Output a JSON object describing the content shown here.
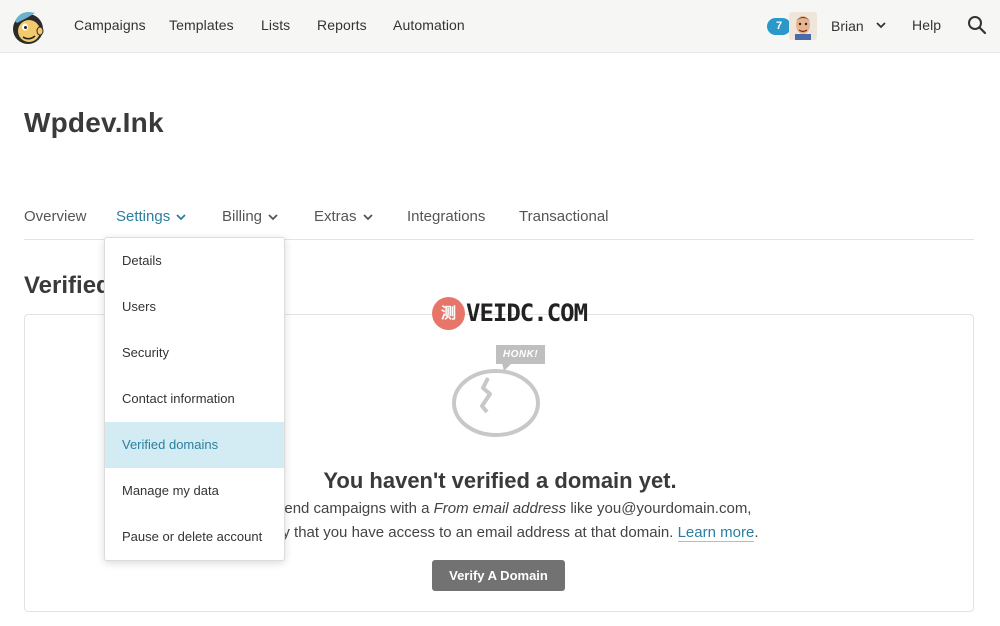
{
  "nav": {
    "links": [
      "Campaigns",
      "Templates",
      "Lists",
      "Reports",
      "Automation"
    ],
    "notification_count": "7",
    "user_name": "Brian",
    "help": "Help"
  },
  "page": {
    "title": "Wpdev.Ink",
    "section_heading": "Verified"
  },
  "tabs": [
    {
      "label": "Overview"
    },
    {
      "label": "Settings"
    },
    {
      "label": "Billing"
    },
    {
      "label": "Extras"
    },
    {
      "label": "Integrations"
    },
    {
      "label": "Transactional"
    }
  ],
  "dropdown": {
    "items": [
      "Details",
      "Users",
      "Security",
      "Contact information",
      "Verified domains",
      "Manage my data",
      "Pause or delete account"
    ],
    "selected": "Verified domains"
  },
  "empty_state": {
    "illustration_label": "HONK!",
    "title": "You haven't verified a domain yet.",
    "line1_prefix": "can send campaigns with a",
    "line1_italic": "From email address",
    "line1_suffix": "like you@yourdomain.com,",
    "line2_prefix": "o verify that you have access to an email address at that domain.",
    "learn_more": "Learn more",
    "line2_suffix": ".",
    "button": "Verify A Domain"
  },
  "watermark": {
    "glyph": "测",
    "text": "VEIDC.COM"
  },
  "colors": {
    "accent": "#2a7fa0",
    "badge": "#2a98c8",
    "button": "#727272",
    "selected_bg": "#d3ecf4"
  }
}
